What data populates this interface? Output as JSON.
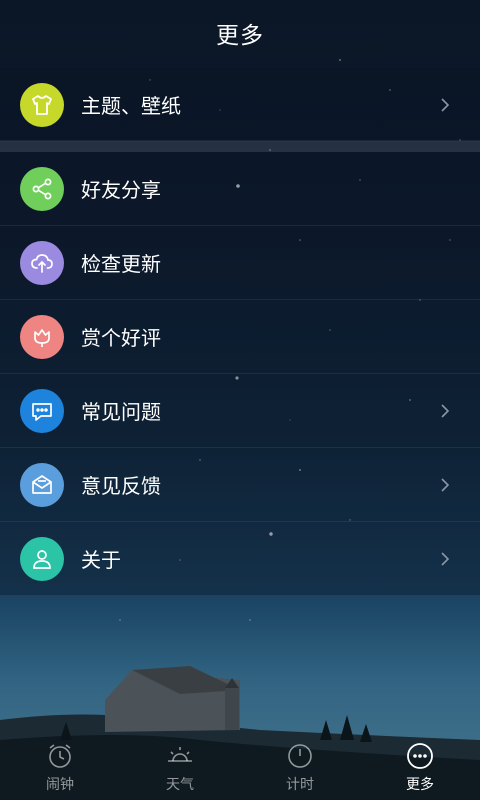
{
  "header": {
    "title": "更多"
  },
  "menu_group1": [
    {
      "label": "主题、壁纸",
      "icon": "tshirt-icon",
      "color": "#c6d82a",
      "chevron": true
    }
  ],
  "menu_group2": [
    {
      "label": "好友分享",
      "icon": "share-icon",
      "color": "#6fcf5a",
      "chevron": false
    },
    {
      "label": "检查更新",
      "icon": "cloud-update-icon",
      "color": "#9b8be0",
      "chevron": false
    },
    {
      "label": "赏个好评",
      "icon": "flower-icon",
      "color": "#ee8582",
      "chevron": false
    },
    {
      "label": "常见问题",
      "icon": "chat-bubble-icon",
      "color": "#1e83dc",
      "chevron": true
    },
    {
      "label": "意见反馈",
      "icon": "mail-icon",
      "color": "#5b9ede",
      "chevron": true
    },
    {
      "label": "关于",
      "icon": "person-icon",
      "color": "#2cc4a6",
      "chevron": true
    }
  ],
  "tabs": [
    {
      "label": "闹钟",
      "icon": "alarm-clock-icon",
      "active": false
    },
    {
      "label": "天气",
      "icon": "sun-icon",
      "active": false
    },
    {
      "label": "计时",
      "icon": "timer-icon",
      "active": false
    },
    {
      "label": "更多",
      "icon": "more-dots-icon",
      "active": true
    }
  ]
}
